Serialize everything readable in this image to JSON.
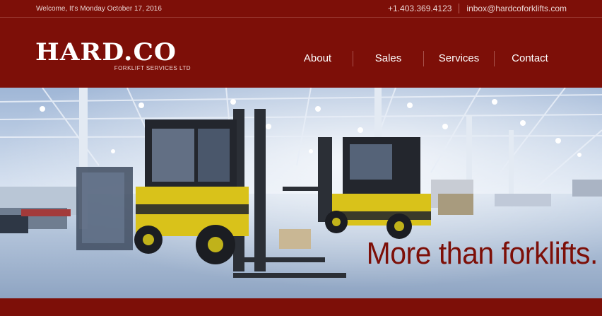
{
  "topbar": {
    "welcome": "Welcome, It's Monday October 17, 2016",
    "phone": "+1.403.369.4123",
    "email": "inbox@hardcoforklifts.com"
  },
  "brand": {
    "name": "HARD.CO",
    "subtitle": "FORKLIFT SERVICES LTD"
  },
  "nav": {
    "items": [
      "About",
      "Sales",
      "Services",
      "Contact"
    ]
  },
  "hero": {
    "tagline": "More than forklifts.",
    "image": "warehouse-forklifts-photo"
  },
  "colors": {
    "brand_red": "#7d0f08",
    "forklift_yellow": "#d9c21a"
  }
}
